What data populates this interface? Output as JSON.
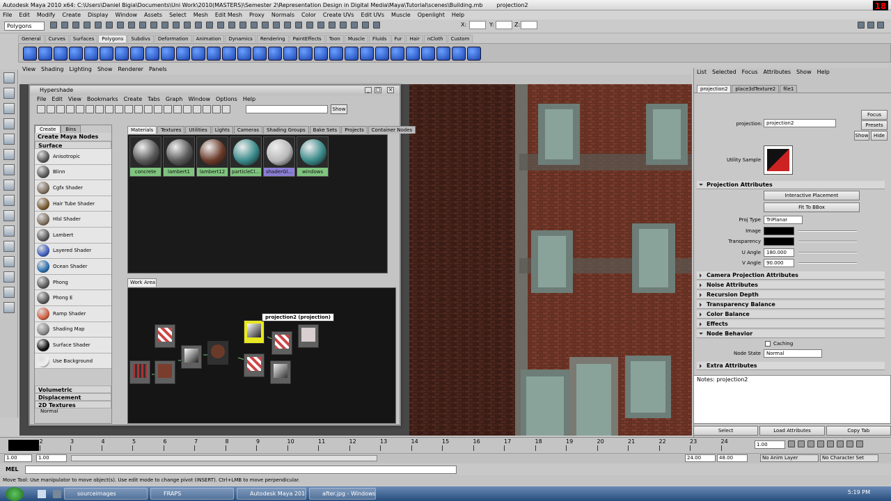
{
  "window": {
    "title": "Autodesk Maya 2010 x64: C:\\Users\\Daniel Bigia\\Documents\\Uni Work\\2010(MASTERS)\\Semester 2\\Representation Design in Digital Media\\Maya\\Tutorial\\scenes\\Building.mb",
    "object": "projection2",
    "fps": "18"
  },
  "menubar": [
    "File",
    "Edit",
    "Modify",
    "Create",
    "Display",
    "Window",
    "Assets",
    "Select",
    "Mesh",
    "Edit Mesh",
    "Proxy",
    "Normals",
    "Color",
    "Create UVs",
    "Edit UVs",
    "Muscle",
    "Openlight",
    "Help"
  ],
  "statusline": {
    "mode": "Polygons",
    "x_label": "X:",
    "y_label": "Y:",
    "z_label": "Z:"
  },
  "shelf_tabs": [
    "General",
    "Curves",
    "Surfaces",
    "Polygons",
    "Subdivs",
    "Deformation",
    "Animation",
    "Dynamics",
    "Rendering",
    "PaintEffects",
    "Toon",
    "Muscle",
    "Fluids",
    "Fur",
    "Hair",
    "nCloth",
    "Custom"
  ],
  "panel_menu": [
    "View",
    "Shading",
    "Lighting",
    "Show",
    "Renderer",
    "Panels"
  ],
  "hypershade": {
    "title": "Hypershade",
    "menu": [
      "File",
      "Edit",
      "View",
      "Bookmarks",
      "Create",
      "Tabs",
      "Graph",
      "Window",
      "Options",
      "Help"
    ],
    "show_label": "Show",
    "create_tabs": [
      "Create",
      "Bins"
    ],
    "create_header": "Create Maya Nodes",
    "category_surface": "Surface",
    "shaders": [
      {
        "name": "Anisotropic",
        "color": "#5a5a5a"
      },
      {
        "name": "Blinn",
        "color": "#5a5a5a"
      },
      {
        "name": "Cgfx Shader",
        "color": "#807060"
      },
      {
        "name": "Hair Tube Shader",
        "color": "#7a5a30"
      },
      {
        "name": "Hlsl Shader",
        "color": "#807060"
      },
      {
        "name": "Lambert",
        "color": "#5a5a5a"
      },
      {
        "name": "Layered Shader",
        "color": "#4060c0"
      },
      {
        "name": "Ocean Shader",
        "color": "#2a70b0"
      },
      {
        "name": "Phong",
        "color": "#5a5a5a"
      },
      {
        "name": "Phong E",
        "color": "#5a5a5a"
      },
      {
        "name": "Ramp Shader",
        "color": "#d06040"
      },
      {
        "name": "Shading Map",
        "color": "#888888"
      },
      {
        "name": "Surface Shader",
        "color": "#111111"
      },
      {
        "name": "Use Background",
        "color": "#f0f0f0"
      }
    ],
    "categories_more": [
      "Volumetric",
      "Displacement",
      "2D Textures"
    ],
    "partial_item": "Normal",
    "mat_tabs": [
      "Materials",
      "Textures",
      "Utilities",
      "Lights",
      "Cameras",
      "Shading Groups",
      "Bake Sets",
      "Projects",
      "Container Nodes"
    ],
    "materials": [
      {
        "name": "concrete",
        "color": "#5a5a5a",
        "label_bg": "#7fc47f"
      },
      {
        "name": "lambert1",
        "color": "#5a5a5a",
        "label_bg": "#7fc47f"
      },
      {
        "name": "lambert12",
        "color": "#6a3a28",
        "label_bg": "#7fc47f"
      },
      {
        "name": "particleCl...",
        "color": "#3a8a8a",
        "label_bg": "#7fc47f"
      },
      {
        "name": "shaderGl...",
        "color": "#b8b8b8",
        "label_bg": "#8a7fd4"
      },
      {
        "name": "windows",
        "color": "#3a8a8a",
        "label_bg": "#7fc47f"
      }
    ],
    "work_tab": "Work Area",
    "tooltip": "projection2 (projection)"
  },
  "attr_editor": {
    "menu": [
      "List",
      "Selected",
      "Focus",
      "Attributes",
      "Show",
      "Help"
    ],
    "tabs": [
      "projection2",
      "place3dTexture2",
      "file1"
    ],
    "node_label": "projection:",
    "node_name": "projection2",
    "focus": "Focus",
    "presets": "Presets",
    "show": "Show",
    "hide": "Hide",
    "sample_label": "Utility Sample",
    "frame_projection": "Projection Attributes",
    "interactive": "Interactive Placement",
    "fit": "Fit To BBox",
    "proj_type_label": "Proj Type",
    "proj_type": "TriPlanar",
    "image_label": "Image",
    "transparency_label": "Transparency",
    "u_angle_label": "U Angle",
    "u_angle": "180.000",
    "v_angle_label": "V Angle",
    "v_angle": "90.000",
    "frames": [
      "Camera Projection Attributes",
      "Noise Attributes",
      "Recursion Depth",
      "Transparency Balance",
      "Color Balance",
      "Effects"
    ],
    "frame_node": "Node Behavior",
    "caching": "Caching",
    "node_state_label": "Node State",
    "node_state": "Normal",
    "frame_extra": "Extra Attributes",
    "notes": "Notes:  projection2",
    "buttons": [
      "Select",
      "Load Attributes",
      "Copy Tab"
    ]
  },
  "timeline": {
    "ticks": [
      "1",
      "2",
      "3",
      "4",
      "5",
      "6",
      "7",
      "8",
      "9",
      "10",
      "11",
      "12",
      "13",
      "14",
      "15",
      "16",
      "17",
      "18",
      "19",
      "20",
      "21",
      "22",
      "23",
      "24"
    ],
    "current": "1.00"
  },
  "range": {
    "start": "1.00",
    "start2": "1.00",
    "end": "24.00",
    "end2": "48.00",
    "anim_layer": "No Anim Layer",
    "character": "No Character Set"
  },
  "mel_label": "MEL",
  "help": "Move Tool: Use manipulator to move object(s). Use edit mode to change pivot (INSERT). Ctrl+LMB to move perpendicular.",
  "taskbar": {
    "items": [
      "sourceimages",
      "FRAPS",
      "Autodesk Maya 2010...",
      "after.jpg - Windows..."
    ],
    "clock": "5:19 PM"
  }
}
